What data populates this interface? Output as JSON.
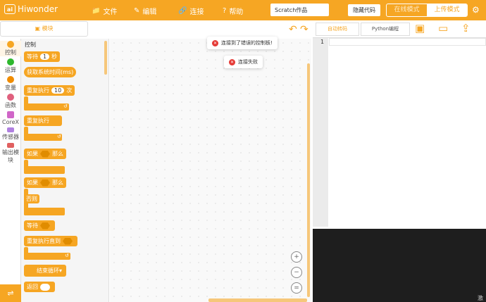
{
  "app": {
    "logo_badge": "ai",
    "logo_text": "Hiwonder"
  },
  "menu": [
    {
      "label": "文件",
      "icon": "📁"
    },
    {
      "label": "编辑",
      "icon": "✎"
    },
    {
      "label": "连接",
      "icon": "🔗"
    },
    {
      "label": "帮助",
      "icon": "?"
    }
  ],
  "project_name": "Scratch作品",
  "hide_code_label": "隐藏代码",
  "modes": {
    "online": "在线模式",
    "upload": "上传模式"
  },
  "toolbar": {
    "block_button": "模块",
    "code_tab": "自动转码",
    "python_tab": "Python编程"
  },
  "categories": [
    {
      "label": "控制",
      "color": "#f6a623"
    },
    {
      "label": "运算",
      "color": "#2eb82e"
    },
    {
      "label": "变量",
      "color": "#f08c00"
    },
    {
      "label": "函数",
      "color": "#e0607e"
    },
    {
      "label": "CoreX",
      "color": "#d066c8"
    },
    {
      "label": "传感器",
      "color": "#b080e0"
    },
    {
      "label": "输出模块",
      "color": "#e06060"
    }
  ],
  "flyout": {
    "title": "控制",
    "wait": {
      "label": "等待",
      "value": "1",
      "unit": "秒"
    },
    "get_time": "获取系统时间(ms)",
    "repeat": {
      "label": "重复执行",
      "value": "10",
      "unit": "次"
    },
    "forever": "重复执行",
    "if_then": {
      "if": "如果",
      "then": "那么"
    },
    "if_else": {
      "if": "如果",
      "then": "那么",
      "else": "否则"
    },
    "wait_until": "等待",
    "repeat_until": "重复执行直到",
    "break_loop": "结束循环",
    "return": "返回"
  },
  "toasts": [
    "连接到了错误的控制板!",
    "连接失败"
  ],
  "editor": {
    "line_numbers": [
      "1"
    ]
  },
  "console": {
    "text": "激"
  }
}
